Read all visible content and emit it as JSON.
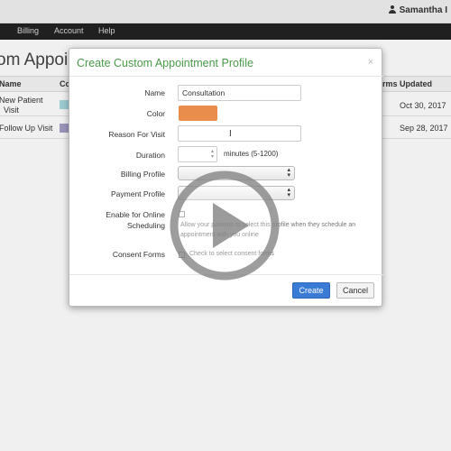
{
  "header": {
    "user_name": "Samantha I",
    "nav_items": [
      {
        "label": "Billing"
      },
      {
        "label": "Account"
      },
      {
        "label": "Help"
      }
    ]
  },
  "page": {
    "heading": "om Appoin"
  },
  "table": {
    "columns": {
      "name": "Name",
      "color": "Co",
      "forms": "rms",
      "updated": "Updated"
    },
    "rows": [
      {
        "name_line1": "New Patient",
        "name_line2": "Visit",
        "swatch_color": "#a6d8e0",
        "updated": "Oct 30, 2017"
      },
      {
        "name": "Follow Up Visit",
        "swatch_color": "#a59fc6",
        "updated": "Sep 28, 2017"
      }
    ]
  },
  "modal": {
    "title": "Create Custom Appointment Profile",
    "close": "×",
    "name_label": "Name",
    "name_value": "Consultation",
    "color_label": "Color",
    "color_value": "#e98d4d",
    "reason_label": "Reason For Visit",
    "reason_value": "",
    "duration_label": "Duration",
    "duration_value": "",
    "duration_hint": "minutes (5-1200)",
    "billing_label": "Billing Profile",
    "billing_value": "",
    "payment_label": "Payment Profile",
    "payment_value": "",
    "online_label_line1": "Enable for Online",
    "online_label_line2": "Scheduling",
    "online_help_line1": "Allow your patients to select this profile when they schedule an",
    "online_help_line2": "appointment with you online",
    "consent_label": "Consent Forms",
    "consent_help": "Check to select consent forms",
    "create_label": "Create",
    "cancel_label": "Cancel"
  },
  "colors": {
    "navbar": "#222222",
    "title_green": "#4a9a4a",
    "primary_button": "#3a7bd5"
  },
  "icons": {
    "user": "user-icon",
    "play": "play-icon",
    "close": "close-icon"
  }
}
